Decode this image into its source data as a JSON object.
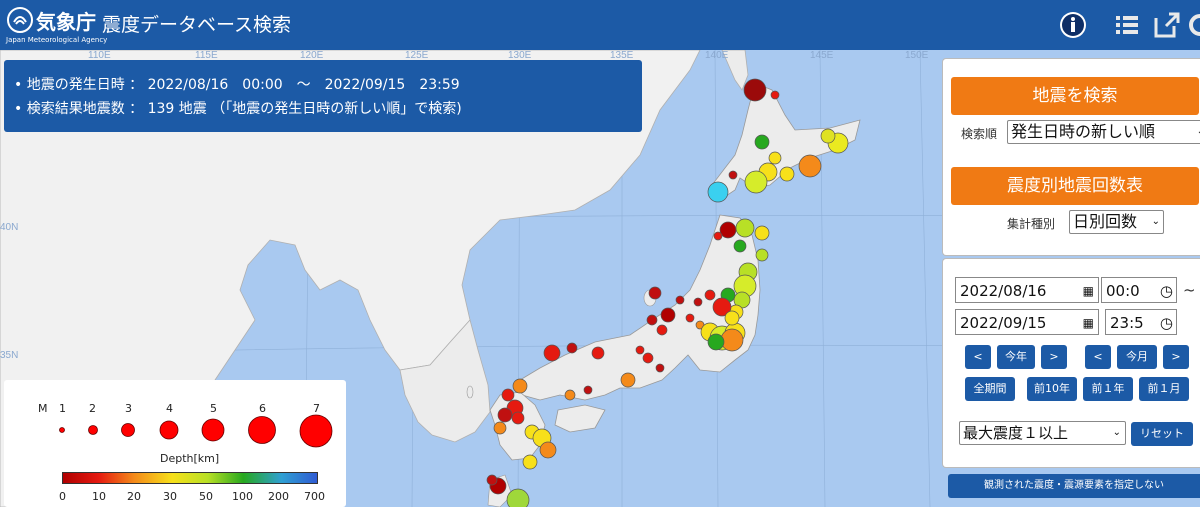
{
  "header": {
    "agency_jp": "気象庁",
    "agency_en": "Japan Meteorological Agency",
    "title": "震度データベース検索"
  },
  "info": {
    "line1": "•  地震の発生日時 ： 2022/08/16　00:00　～　2022/09/15　23:59",
    "line2": "•  検索結果地震数 ： 139 地震 （「地震の発生日時の新しい順」で検索)"
  },
  "map_labels": {
    "lon": [
      "110E",
      "115E",
      "120E",
      "125E",
      "130E",
      "135E",
      "140E",
      "145E",
      "150E"
    ],
    "lat": [
      "40N",
      "35N"
    ]
  },
  "search_panel": {
    "search_button": "地震を検索",
    "sort_label": "検索順",
    "sort_value": "発生日時の新しい順",
    "count_button": "震度別地震回数表",
    "agg_label": "集計種別",
    "agg_value": "日別回数"
  },
  "date_panel": {
    "start_date": "2022/08/16",
    "start_time": "00:0",
    "end_date": "2022/09/15",
    "end_time": "23:5",
    "tilde": "~",
    "prev": "<",
    "next": ">",
    "this_year": "今年",
    "this_month": "今月",
    "all_period": "全期間",
    "prev_10y": "前10年",
    "prev_1y": "前１年",
    "prev_1m": "前１月",
    "intensity_value": "最大震度１以上",
    "reset": "リセット"
  },
  "bottom_button": "観測された震度・震源要素を指定しない",
  "legend": {
    "m_label": "M",
    "magnitudes": [
      "1",
      "2",
      "3",
      "4",
      "5",
      "6",
      "7"
    ],
    "depth_label": "Depth[km]",
    "depth_ticks": [
      "0",
      "10",
      "20",
      "30",
      "50",
      "100",
      "200",
      "700"
    ],
    "depth_colors": [
      "#b00000",
      "#e51a10",
      "#f48a1a",
      "#f7e01a",
      "#b8e026",
      "#27a81f",
      "#2f7bd3"
    ]
  },
  "colors": {
    "header": "#1c5aa6",
    "accent": "#f07a14",
    "sea": "#a9c9f0",
    "land": "#ececec"
  }
}
